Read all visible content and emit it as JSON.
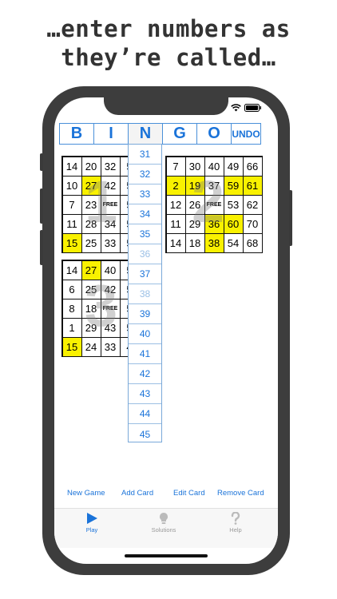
{
  "headline": {
    "line1": "…enter numbers as",
    "line2": "they’re called…"
  },
  "header": {
    "letters": [
      "B",
      "I",
      "N",
      "G",
      "O"
    ],
    "undo_label": "UNDO"
  },
  "cards": [
    {
      "watermark": "1",
      "rows": [
        [
          "14",
          "20",
          "32",
          "5",
          ""
        ],
        [
          "10",
          "27",
          "42",
          "5",
          ""
        ],
        [
          "7",
          "23",
          "FREE",
          "5",
          ""
        ],
        [
          "11",
          "28",
          "34",
          "5",
          ""
        ],
        [
          "15",
          "25",
          "33",
          "5",
          ""
        ]
      ],
      "hits": [
        [
          1,
          1
        ],
        [
          4,
          0
        ]
      ]
    },
    {
      "watermark": "2",
      "rows": [
        [
          "7",
          "30",
          "40",
          "49",
          "66"
        ],
        [
          "2",
          "19",
          "37",
          "59",
          "61"
        ],
        [
          "12",
          "26",
          "FREE",
          "53",
          "62"
        ],
        [
          "11",
          "29",
          "36",
          "60",
          "70"
        ],
        [
          "14",
          "18",
          "38",
          "54",
          "68"
        ]
      ],
      "hits": [
        [
          1,
          0
        ],
        [
          1,
          1
        ],
        [
          1,
          3
        ],
        [
          1,
          4
        ],
        [
          3,
          2
        ],
        [
          3,
          3
        ],
        [
          4,
          2
        ]
      ]
    },
    {
      "watermark": "3",
      "rows": [
        [
          "14",
          "27",
          "40",
          "5",
          ""
        ],
        [
          "6",
          "25",
          "42",
          "5",
          ""
        ],
        [
          "8",
          "18",
          "FREE",
          "5",
          ""
        ],
        [
          "1",
          "29",
          "43",
          "5",
          ""
        ],
        [
          "15",
          "24",
          "33",
          "4",
          ""
        ]
      ],
      "hits": [
        [
          0,
          1
        ],
        [
          4,
          0
        ]
      ]
    }
  ],
  "number_picker": {
    "items": [
      "31",
      "32",
      "33",
      "34",
      "35",
      "36",
      "37",
      "38",
      "39",
      "40",
      "41",
      "42",
      "43",
      "44",
      "45"
    ],
    "dimmed": [
      "36",
      "38"
    ]
  },
  "actions": {
    "new_game": "New Game",
    "add_card": "Add Card",
    "edit_card": "Edit Card",
    "remove_card": "Remove Card"
  },
  "tabs": [
    {
      "label": "Play",
      "icon": "play-icon",
      "active": true
    },
    {
      "label": "Solutions",
      "icon": "lightbulb-icon",
      "active": false
    },
    {
      "label": "Help",
      "icon": "question-icon",
      "active": false
    }
  ],
  "colors": {
    "accent": "#1a73d9",
    "highlight": "#f9f100",
    "phone_frame": "#3d3d3d"
  }
}
